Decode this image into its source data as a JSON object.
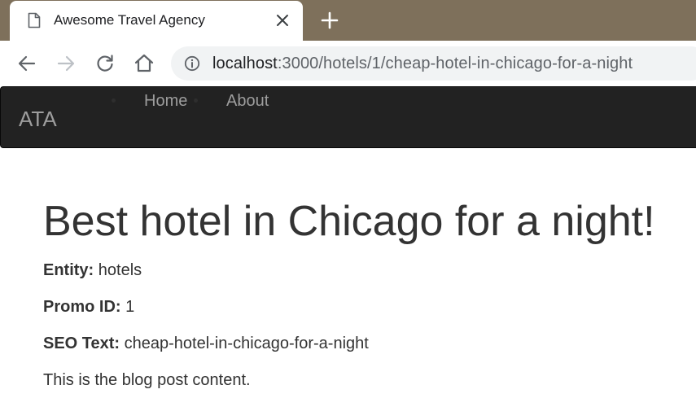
{
  "browser": {
    "tab_title": "Awesome Travel Agency",
    "url_host": "localhost",
    "url_path": ":3000/hotels/1/cheap-hotel-in-chicago-for-a-night",
    "tabstrip_color": "#7e705b"
  },
  "navbar": {
    "brand": "ATA",
    "links": [
      {
        "label": "Home"
      },
      {
        "label": "About"
      }
    ],
    "background_color": "#222222",
    "link_color": "#9d9d9d"
  },
  "post": {
    "title": "Best hotel in Chicago for a night!",
    "entity_label": "Entity:",
    "entity_value": "hotels",
    "promo_label": "Promo ID:",
    "promo_value": "1",
    "seo_label": "SEO Text:",
    "seo_value": "cheap-hotel-in-chicago-for-a-night",
    "body": "This is the blog post content."
  }
}
